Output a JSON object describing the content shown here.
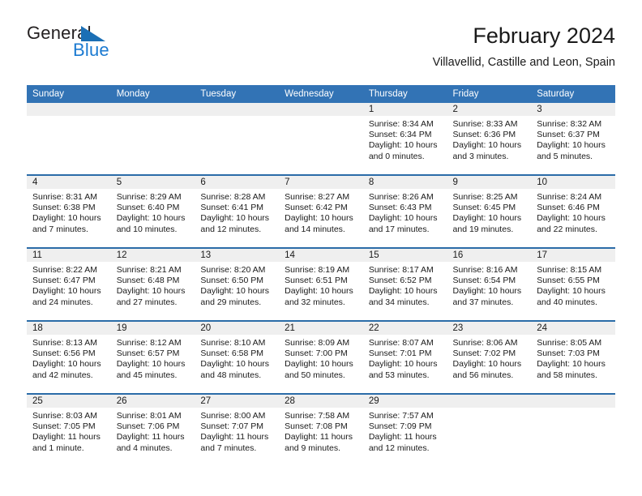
{
  "brand": {
    "name_part1": "General",
    "name_part2": "Blue",
    "triangle_color": "#1b6fb5"
  },
  "header": {
    "title": "February 2024",
    "subtitle": "Villavellid, Castille and Leon, Spain",
    "header_bg_color": "#3273b5",
    "divider_color": "#2b6ca8",
    "datebar_color": "#efefef"
  },
  "weekday_headers": [
    "Sunday",
    "Monday",
    "Tuesday",
    "Wednesday",
    "Thursday",
    "Friday",
    "Saturday"
  ],
  "weeks": [
    [
      {
        "date": "",
        "sunrise": "",
        "sunset": "",
        "daylight": ""
      },
      {
        "date": "",
        "sunrise": "",
        "sunset": "",
        "daylight": ""
      },
      {
        "date": "",
        "sunrise": "",
        "sunset": "",
        "daylight": ""
      },
      {
        "date": "",
        "sunrise": "",
        "sunset": "",
        "daylight": ""
      },
      {
        "date": "1",
        "sunrise": "Sunrise: 8:34 AM",
        "sunset": "Sunset: 6:34 PM",
        "daylight": "Daylight: 10 hours and 0 minutes."
      },
      {
        "date": "2",
        "sunrise": "Sunrise: 8:33 AM",
        "sunset": "Sunset: 6:36 PM",
        "daylight": "Daylight: 10 hours and 3 minutes."
      },
      {
        "date": "3",
        "sunrise": "Sunrise: 8:32 AM",
        "sunset": "Sunset: 6:37 PM",
        "daylight": "Daylight: 10 hours and 5 minutes."
      }
    ],
    [
      {
        "date": "4",
        "sunrise": "Sunrise: 8:31 AM",
        "sunset": "Sunset: 6:38 PM",
        "daylight": "Daylight: 10 hours and 7 minutes."
      },
      {
        "date": "5",
        "sunrise": "Sunrise: 8:29 AM",
        "sunset": "Sunset: 6:40 PM",
        "daylight": "Daylight: 10 hours and 10 minutes."
      },
      {
        "date": "6",
        "sunrise": "Sunrise: 8:28 AM",
        "sunset": "Sunset: 6:41 PM",
        "daylight": "Daylight: 10 hours and 12 minutes."
      },
      {
        "date": "7",
        "sunrise": "Sunrise: 8:27 AM",
        "sunset": "Sunset: 6:42 PM",
        "daylight": "Daylight: 10 hours and 14 minutes."
      },
      {
        "date": "8",
        "sunrise": "Sunrise: 8:26 AM",
        "sunset": "Sunset: 6:43 PM",
        "daylight": "Daylight: 10 hours and 17 minutes."
      },
      {
        "date": "9",
        "sunrise": "Sunrise: 8:25 AM",
        "sunset": "Sunset: 6:45 PM",
        "daylight": "Daylight: 10 hours and 19 minutes."
      },
      {
        "date": "10",
        "sunrise": "Sunrise: 8:24 AM",
        "sunset": "Sunset: 6:46 PM",
        "daylight": "Daylight: 10 hours and 22 minutes."
      }
    ],
    [
      {
        "date": "11",
        "sunrise": "Sunrise: 8:22 AM",
        "sunset": "Sunset: 6:47 PM",
        "daylight": "Daylight: 10 hours and 24 minutes."
      },
      {
        "date": "12",
        "sunrise": "Sunrise: 8:21 AM",
        "sunset": "Sunset: 6:48 PM",
        "daylight": "Daylight: 10 hours and 27 minutes."
      },
      {
        "date": "13",
        "sunrise": "Sunrise: 8:20 AM",
        "sunset": "Sunset: 6:50 PM",
        "daylight": "Daylight: 10 hours and 29 minutes."
      },
      {
        "date": "14",
        "sunrise": "Sunrise: 8:19 AM",
        "sunset": "Sunset: 6:51 PM",
        "daylight": "Daylight: 10 hours and 32 minutes."
      },
      {
        "date": "15",
        "sunrise": "Sunrise: 8:17 AM",
        "sunset": "Sunset: 6:52 PM",
        "daylight": "Daylight: 10 hours and 34 minutes."
      },
      {
        "date": "16",
        "sunrise": "Sunrise: 8:16 AM",
        "sunset": "Sunset: 6:54 PM",
        "daylight": "Daylight: 10 hours and 37 minutes."
      },
      {
        "date": "17",
        "sunrise": "Sunrise: 8:15 AM",
        "sunset": "Sunset: 6:55 PM",
        "daylight": "Daylight: 10 hours and 40 minutes."
      }
    ],
    [
      {
        "date": "18",
        "sunrise": "Sunrise: 8:13 AM",
        "sunset": "Sunset: 6:56 PM",
        "daylight": "Daylight: 10 hours and 42 minutes."
      },
      {
        "date": "19",
        "sunrise": "Sunrise: 8:12 AM",
        "sunset": "Sunset: 6:57 PM",
        "daylight": "Daylight: 10 hours and 45 minutes."
      },
      {
        "date": "20",
        "sunrise": "Sunrise: 8:10 AM",
        "sunset": "Sunset: 6:58 PM",
        "daylight": "Daylight: 10 hours and 48 minutes."
      },
      {
        "date": "21",
        "sunrise": "Sunrise: 8:09 AM",
        "sunset": "Sunset: 7:00 PM",
        "daylight": "Daylight: 10 hours and 50 minutes."
      },
      {
        "date": "22",
        "sunrise": "Sunrise: 8:07 AM",
        "sunset": "Sunset: 7:01 PM",
        "daylight": "Daylight: 10 hours and 53 minutes."
      },
      {
        "date": "23",
        "sunrise": "Sunrise: 8:06 AM",
        "sunset": "Sunset: 7:02 PM",
        "daylight": "Daylight: 10 hours and 56 minutes."
      },
      {
        "date": "24",
        "sunrise": "Sunrise: 8:05 AM",
        "sunset": "Sunset: 7:03 PM",
        "daylight": "Daylight: 10 hours and 58 minutes."
      }
    ],
    [
      {
        "date": "25",
        "sunrise": "Sunrise: 8:03 AM",
        "sunset": "Sunset: 7:05 PM",
        "daylight": "Daylight: 11 hours and 1 minute."
      },
      {
        "date": "26",
        "sunrise": "Sunrise: 8:01 AM",
        "sunset": "Sunset: 7:06 PM",
        "daylight": "Daylight: 11 hours and 4 minutes."
      },
      {
        "date": "27",
        "sunrise": "Sunrise: 8:00 AM",
        "sunset": "Sunset: 7:07 PM",
        "daylight": "Daylight: 11 hours and 7 minutes."
      },
      {
        "date": "28",
        "sunrise": "Sunrise: 7:58 AM",
        "sunset": "Sunset: 7:08 PM",
        "daylight": "Daylight: 11 hours and 9 minutes."
      },
      {
        "date": "29",
        "sunrise": "Sunrise: 7:57 AM",
        "sunset": "Sunset: 7:09 PM",
        "daylight": "Daylight: 11 hours and 12 minutes."
      },
      {
        "date": "",
        "sunrise": "",
        "sunset": "",
        "daylight": ""
      },
      {
        "date": "",
        "sunrise": "",
        "sunset": "",
        "daylight": ""
      }
    ]
  ]
}
